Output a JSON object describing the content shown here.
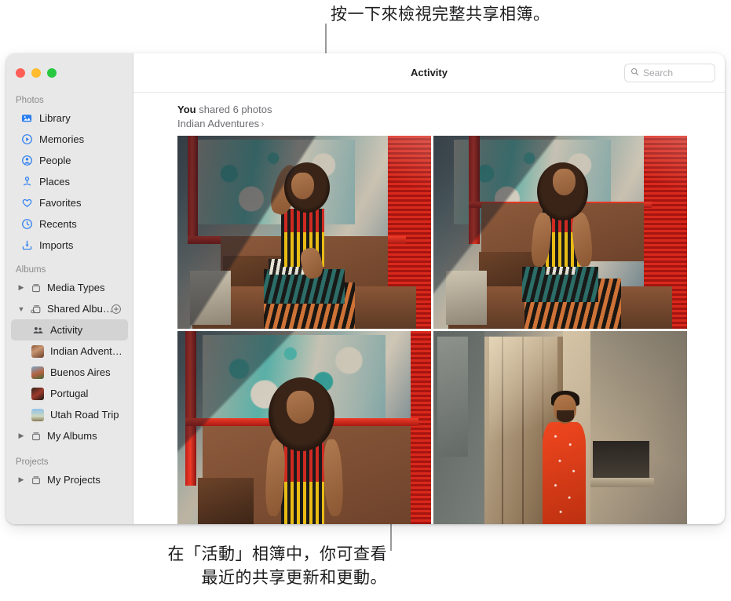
{
  "callouts": {
    "top": "按一下來檢視完整共享相簿。",
    "bottom": "在「活動」相簿中，你可查看\n最近的共享更新和更動。"
  },
  "window": {
    "traffic_lights": {
      "close_label": "close-window",
      "minimize_label": "minimize-window",
      "maximize_label": "maximize-window",
      "close_color": "#ff5f57",
      "minimize_color": "#febc2e",
      "maximize_color": "#28c840"
    }
  },
  "toolbar": {
    "title": "Activity",
    "search_placeholder": "Search",
    "search_value": ""
  },
  "sidebar": {
    "sections": [
      {
        "title": "Photos",
        "items": [
          {
            "label": "Library",
            "icon": "photos-library-icon"
          },
          {
            "label": "Memories",
            "icon": "memories-icon"
          },
          {
            "label": "People",
            "icon": "people-icon"
          },
          {
            "label": "Places",
            "icon": "places-pin-icon"
          },
          {
            "label": "Favorites",
            "icon": "heart-icon"
          },
          {
            "label": "Recents",
            "icon": "clock-icon"
          },
          {
            "label": "Imports",
            "icon": "import-icon"
          }
        ]
      },
      {
        "title": "Albums",
        "items": [
          {
            "label": "Media Types",
            "icon": "album-box-icon",
            "disclosure": "collapsed"
          },
          {
            "label": "Shared Albu…",
            "icon": "shared-album-box-icon",
            "disclosure": "expanded",
            "add_button": "add-shared-album-button"
          },
          {
            "label": "Activity",
            "icon": "activity-people-icon",
            "selected": true
          },
          {
            "label": "Indian Advent…",
            "icon": "album-thumbnail-indian"
          },
          {
            "label": "Buenos Aires",
            "icon": "album-thumbnail-buenos"
          },
          {
            "label": "Portugal",
            "icon": "album-thumbnail-portugal"
          },
          {
            "label": "Utah Road Trip",
            "icon": "album-thumbnail-utah"
          },
          {
            "label": "My Albums",
            "icon": "album-box-icon",
            "disclosure": "collapsed"
          }
        ]
      },
      {
        "title": "Projects",
        "items": [
          {
            "label": "My Projects",
            "icon": "album-box-icon",
            "disclosure": "collapsed"
          }
        ]
      }
    ]
  },
  "activity": {
    "actor": "You",
    "action": "shared 6 photos",
    "album_name": "Indian Adventures",
    "album_chevron": "›",
    "photos": [
      {
        "name": "woman-seated-hand-on-head"
      },
      {
        "name": "woman-seated-looking-away"
      },
      {
        "name": "woman-standing-eyes-closed"
      },
      {
        "name": "man-in-orange-kurta"
      }
    ]
  },
  "colors": {
    "sidebar_bg": "#e8e8e8",
    "selected_row": "#d3d3d3",
    "accent_blue": "#2a7ef0",
    "secondary_text": "#6e6e73"
  }
}
